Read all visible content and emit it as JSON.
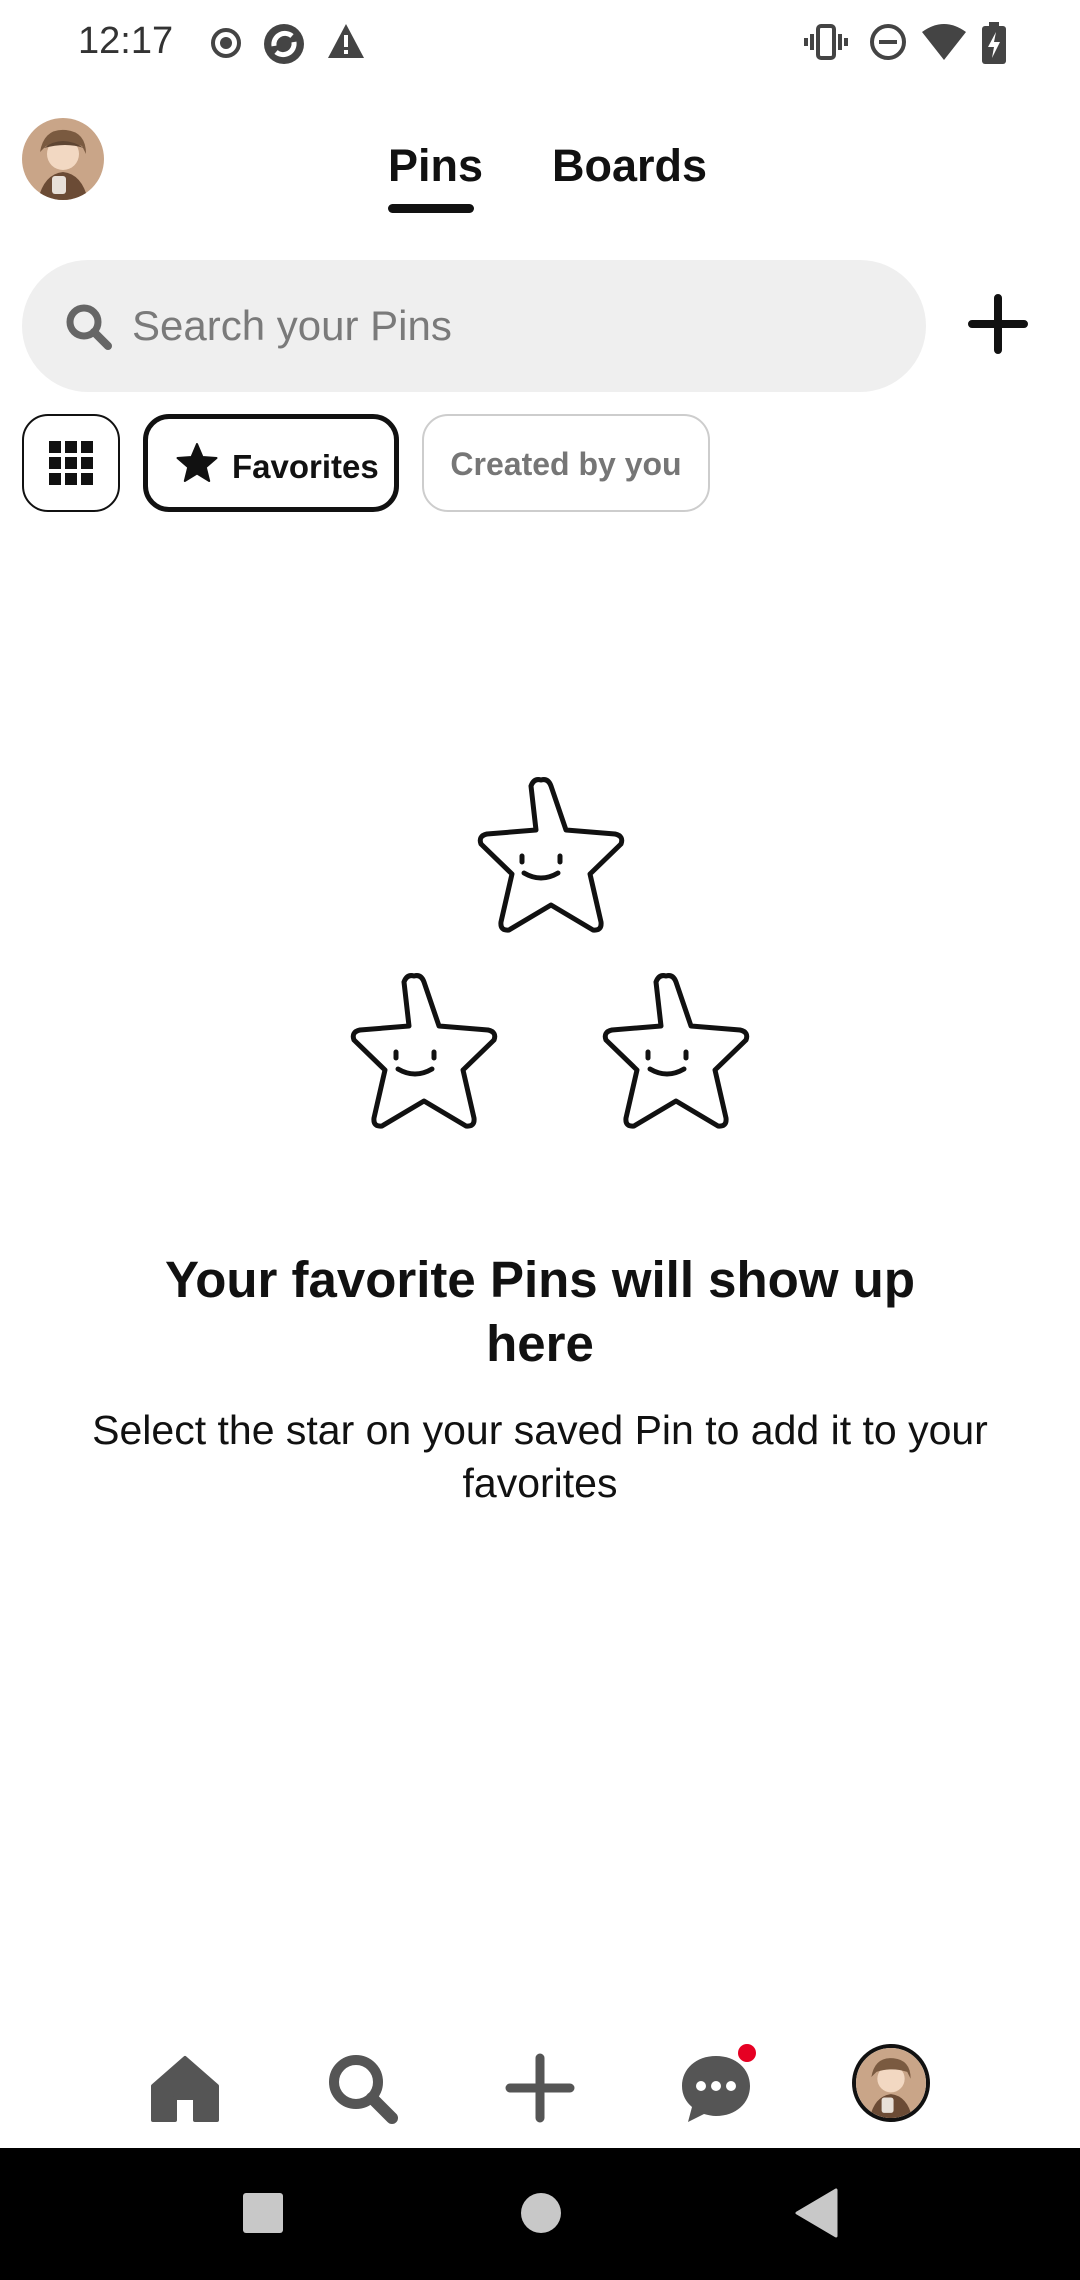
{
  "status_bar": {
    "time": "12:17",
    "left_icons": [
      "record-icon",
      "sync-icon",
      "warning-icon"
    ],
    "right_icons": [
      "vibrate-icon",
      "do-not-disturb-icon",
      "wifi-icon",
      "battery-charging-icon"
    ]
  },
  "header": {
    "tabs": [
      {
        "label": "Pins",
        "active": true
      },
      {
        "label": "Boards",
        "active": false
      }
    ]
  },
  "search": {
    "placeholder": "Search your Pins"
  },
  "filters": {
    "chips": [
      {
        "icon": "grid-icon",
        "active": false
      },
      {
        "icon": "star-icon",
        "label": "Favorites",
        "active": true
      },
      {
        "label": "Created by you",
        "active": false
      }
    ]
  },
  "empty_state": {
    "illustration": "smiling-stars-icon",
    "title": "Your favorite Pins will show up here",
    "subtitle": "Select the star on your saved Pin to add it to your favorites"
  },
  "bottom_nav": {
    "items": [
      "home-icon",
      "search-icon",
      "create-icon",
      "messages-icon",
      "profile-avatar"
    ],
    "messages_has_notification": true
  },
  "colors": {
    "notification": "#e60023",
    "search_bg": "#efefef",
    "text": "#111111"
  }
}
